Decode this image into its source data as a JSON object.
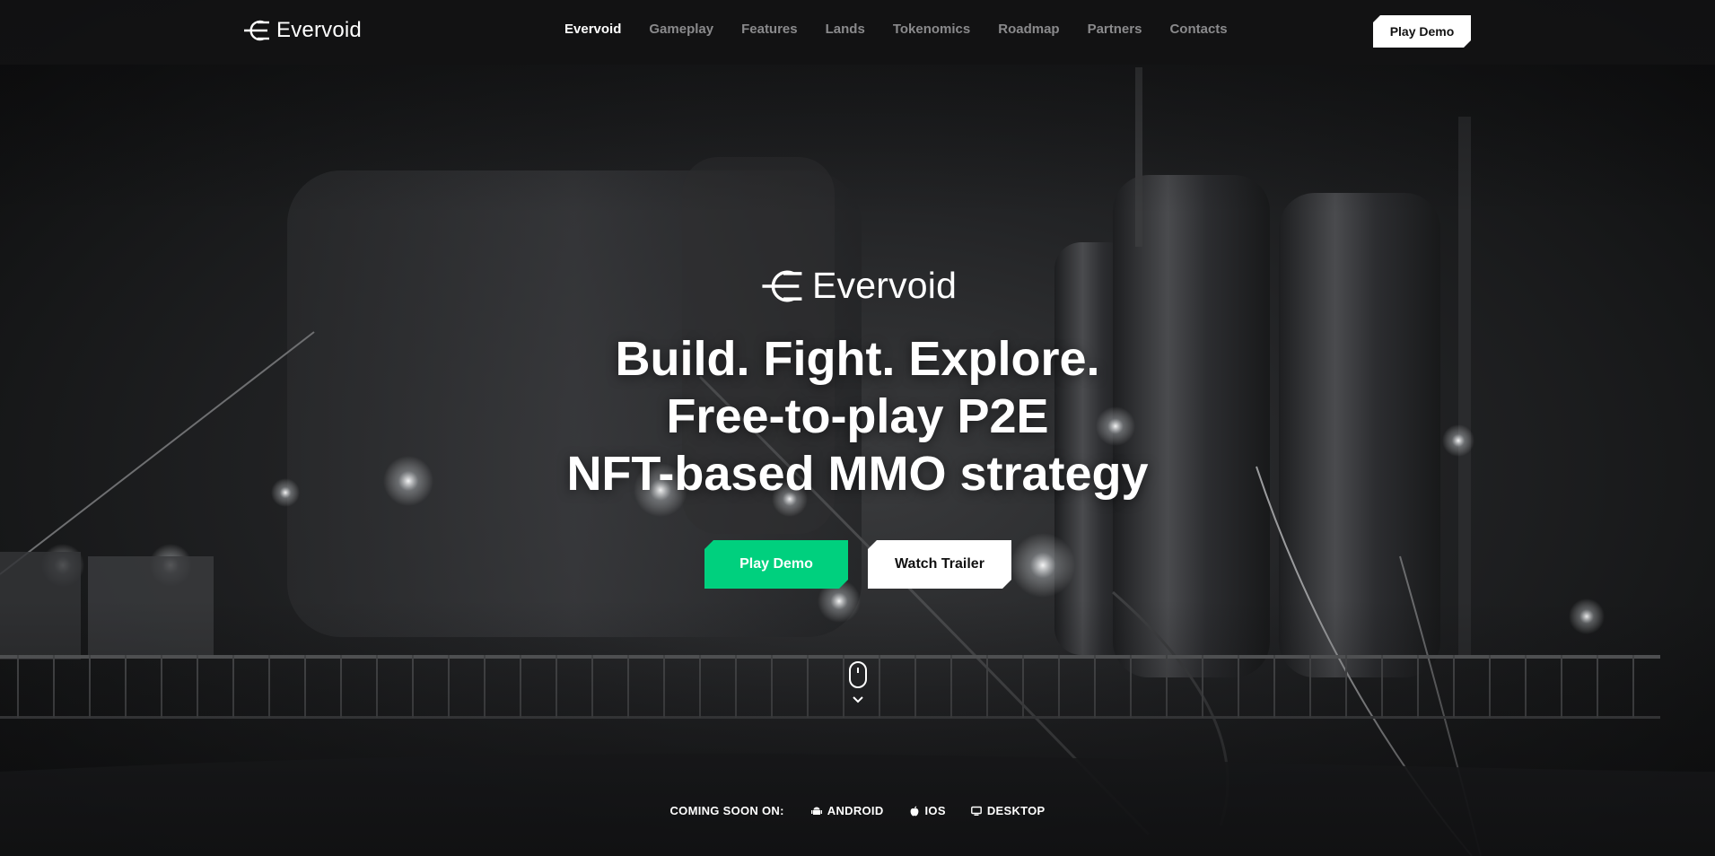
{
  "brand": {
    "name": "Evervoid"
  },
  "nav": {
    "items": [
      {
        "label": "Evervoid",
        "active": true
      },
      {
        "label": "Gameplay"
      },
      {
        "label": "Features"
      },
      {
        "label": "Lands"
      },
      {
        "label": "Tokenomics"
      },
      {
        "label": "Roadmap"
      },
      {
        "label": "Partners"
      },
      {
        "label": "Contacts"
      }
    ],
    "cta_label": "Play Demo"
  },
  "hero": {
    "logo_text": "Evervoid",
    "headline_lines": [
      "Build. Fight. Explore.",
      "Free-to-play P2E",
      "NFT-based MMO strategy"
    ],
    "play_label": "Play Demo",
    "trailer_label": "Watch Trailer"
  },
  "platforms": {
    "label": "COMING SOON ON:",
    "items": [
      {
        "label": "ANDROID",
        "icon": "android-icon"
      },
      {
        "label": "IOS",
        "icon": "apple-icon"
      },
      {
        "label": "DESKTOP",
        "icon": "desktop-icon"
      }
    ]
  },
  "colors": {
    "accent": "#00d07e",
    "background": "#0d0d0e",
    "header": "#121213"
  }
}
